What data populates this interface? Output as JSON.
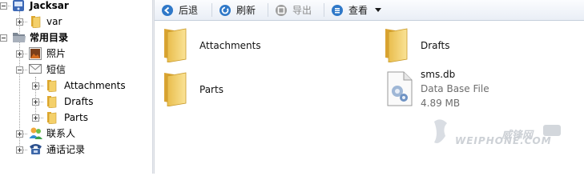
{
  "tree": {
    "device": "Jacksar",
    "var": "var",
    "common_dir": "常用目录",
    "photos": "照片",
    "sms": "短信",
    "attachments": "Attachments",
    "drafts": "Drafts",
    "parts": "Parts",
    "contacts": "联系人",
    "call_log": "通话记录"
  },
  "toolbar": {
    "back": "后退",
    "refresh": "刷新",
    "export": "导出",
    "view": "查看"
  },
  "content": {
    "items": [
      {
        "name": "Attachments"
      },
      {
        "name": "Drafts"
      },
      {
        "name": "Parts"
      },
      {
        "name": "sms.db",
        "type": "Data Base File",
        "size": "4.89 MB"
      }
    ]
  },
  "watermark": {
    "brand": "威锋网",
    "domain": "WEIPHONE.COM"
  },
  "colors": {
    "folder": "#f1c65c",
    "toolbar_icon": "#2f78c8"
  }
}
